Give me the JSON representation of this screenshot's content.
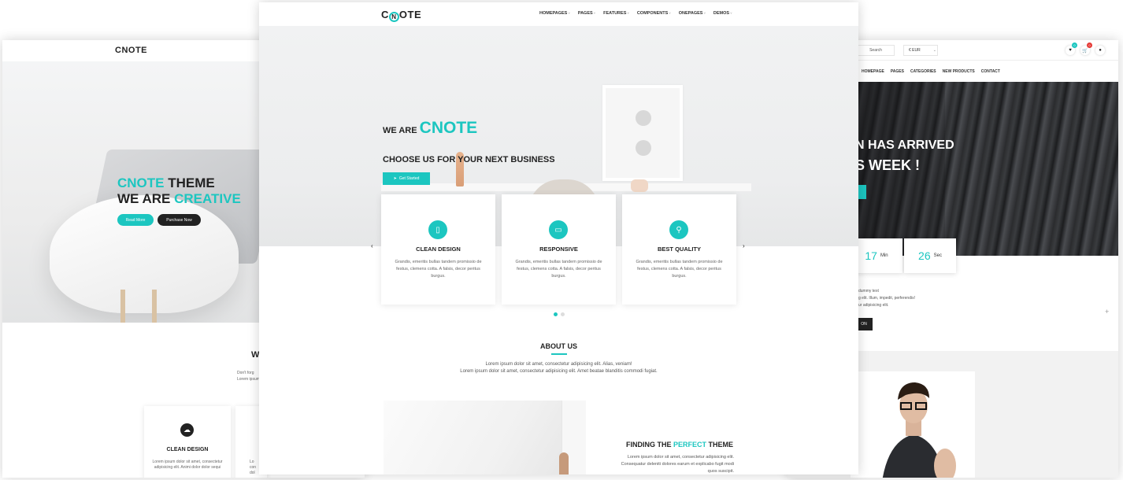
{
  "brand": {
    "accent": "#1cc6c0",
    "dark": "#222222"
  },
  "left": {
    "logo": "CNOTE",
    "hero": {
      "line1_accent": "CNOTE",
      "line1_rest": " THEME",
      "line2_start": "WE ARE ",
      "line2_accent": "CREATIVE"
    },
    "buttons": {
      "read_more": "Read More",
      "purchase_now": "Purchase Now"
    },
    "section_title_partial": "W",
    "section_text_partial": [
      "Don't forg",
      "Lorem ipsum dolo"
    ],
    "card": {
      "icon": "cloud-icon",
      "title": "CLEAN DESIGN",
      "text": "Lorem ipsum dolor sit amet, consectetur adipisicing elit. Animi dolor dolor sequi"
    },
    "card2_text": [
      "Lo",
      "con",
      "dol"
    ]
  },
  "center": {
    "logo": {
      "c": "C",
      "n": "N",
      "rest": "OTE"
    },
    "menu": [
      "HOMEPAGES",
      "PAGES",
      "FEATURES",
      "COMPONENTS",
      "ONEPAGES",
      "DEMOS"
    ],
    "hero": {
      "we_are": "WE ARE ",
      "brand": "CNOTE",
      "subtitle": "CHOOSE US FOR YOUR NEXT BUSINESS",
      "cta": "Get Started"
    },
    "features": [
      {
        "icon": "mobile-icon",
        "title": "CLEAN DESIGN",
        "text": "Grandis, emeritis bullas tandem promissio de festus, clemens cotta. A falsis, decor peritus burgus."
      },
      {
        "icon": "monitor-icon",
        "title": "RESPONSIVE",
        "text": "Grandis, emeritis bullas tandem promissio de festus, clemens cotta. A falsis, decor peritus burgus."
      },
      {
        "icon": "lightbulb-icon",
        "title": "BEST QUALITY",
        "text": "Grandis, emeritis bullas tandem promissio de festus, clemens cotta. A falsis, decor peritus burgus."
      }
    ],
    "slider": {
      "prev": "‹",
      "next": "›",
      "dot_count": 2,
      "active_dot": 1
    },
    "about": {
      "title": "ABOUT US",
      "line1": "Lorem ipsum dolor sit amet, consectetur adipisicing elit. Alias, veniam!",
      "line2": "Lorem ipsum dolor sit amet, consectetur adipisicing elit. Amet beatae blanditis commodi fugiat."
    },
    "finding": {
      "pre": "FINDING THE ",
      "accent": "PERFECT",
      "post": " THEME",
      "line1": "Lorem ipsum dolor sit amet, consectetur adipisicing elit.",
      "line2": "Consequatur deleniti dolores earum et explicabo fugit modi",
      "line3": "quos suscipit."
    }
  },
  "right": {
    "search_label": "Search",
    "currency": {
      "value": "€ EUR",
      "chevron": "chevron-down-icon"
    },
    "icons": [
      {
        "name": "heart-icon",
        "badge": "0",
        "badge_color": "#1cc6c0"
      },
      {
        "name": "cart-icon",
        "badge": "0",
        "badge_color": "#e53935"
      },
      {
        "name": "user-icon"
      }
    ],
    "nav": [
      "HOMEPAGE",
      "PAGES",
      "CATEGORIES",
      "NEW PRODUCTS",
      "CONTACT"
    ],
    "hero": {
      "line1": "N HAS ARRIVED",
      "line2": "S WEEK !"
    },
    "countdown": [
      {
        "value": "17",
        "unit": "Min"
      },
      {
        "value": "26",
        "unit": "Sec"
      }
    ],
    "text_lines": [
      "dummy text",
      "g elit. Illum, impedit, perferendis!",
      "ur adipisicing elit."
    ],
    "dark_button": "ON",
    "plus": "+"
  }
}
